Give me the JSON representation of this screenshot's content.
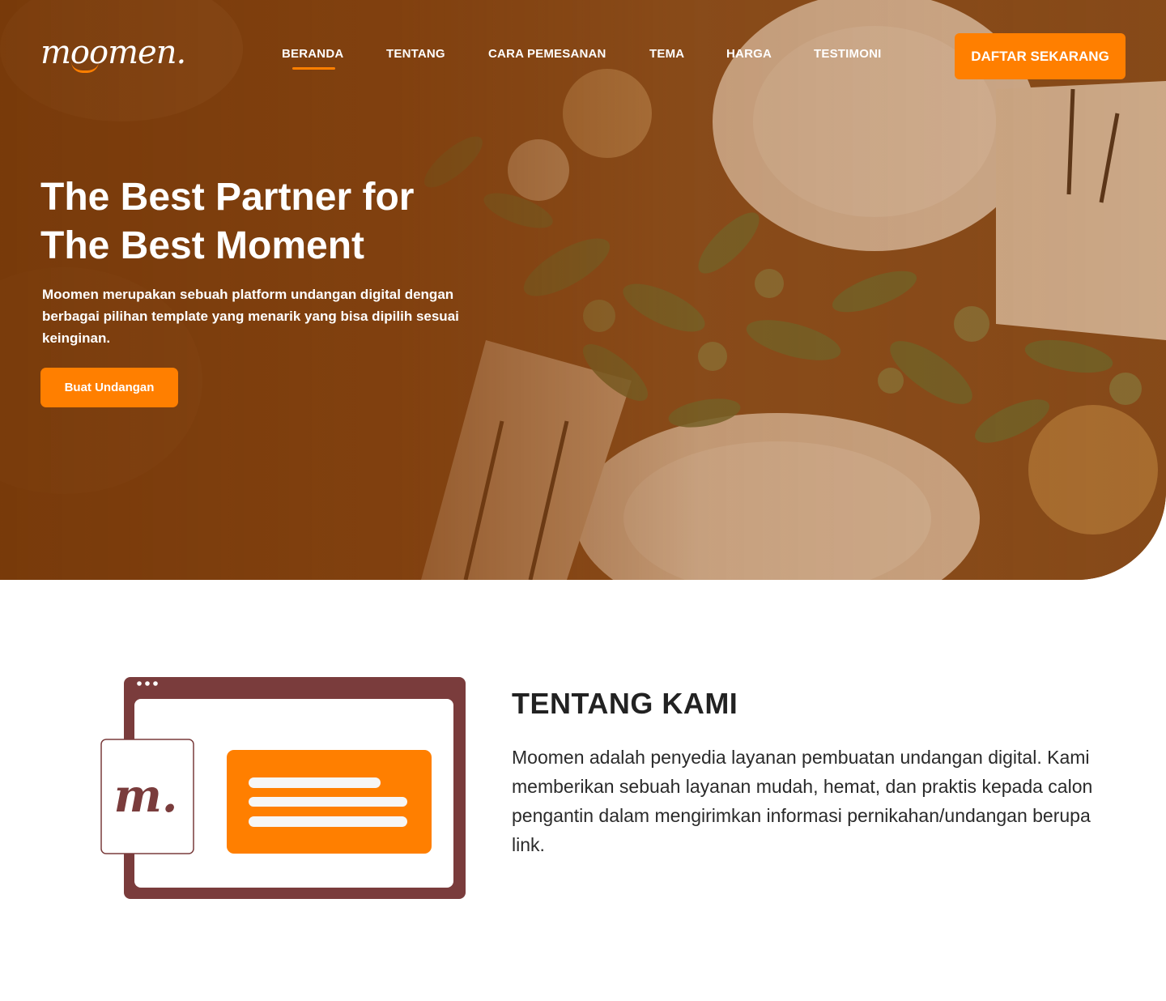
{
  "brand": {
    "logo_text": "moomen.",
    "accent_color": "#ff7f00",
    "brown_color": "#7a3c3c"
  },
  "nav": {
    "items": [
      "BERANDA",
      "TENTANG",
      "CARA PEMESANAN",
      "TEMA",
      "HARGA",
      "TESTIMONI"
    ],
    "active": "BERANDA",
    "cta_label": "DAFTAR SEKARANG"
  },
  "hero": {
    "title_line1": "The Best Partner for",
    "title_line2": "The Best Moment",
    "description": "Moomen merupakan sebuah platform undangan digital  dengan berbagai pilihan template yang menarik yang bisa dipilih sesuai keinginan.",
    "button_label": "Buat Undangan"
  },
  "about": {
    "title": "TENTANG KAMI",
    "text": "Moomen adalah penyedia layanan pembuatan undangan digital. Kami memberikan sebuah layanan mudah, hemat, dan praktis kepada calon pengantin dalam mengirimkan informasi pernikahan/undangan berupa link.",
    "illustration_mark": "m."
  }
}
